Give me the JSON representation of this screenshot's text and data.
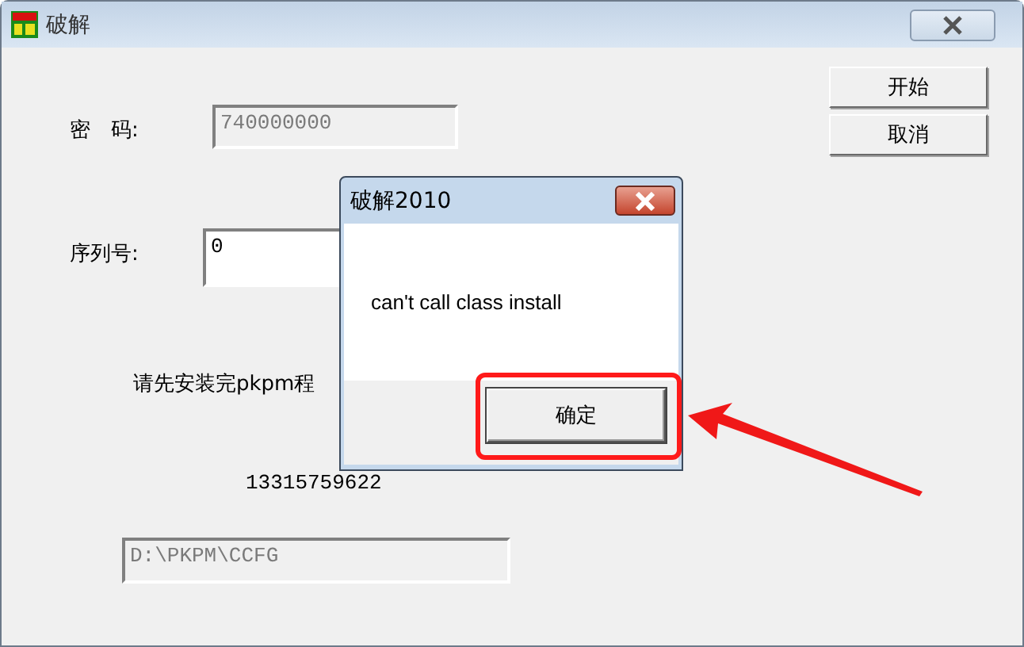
{
  "window": {
    "title": "破解"
  },
  "fields": [
    {
      "label": "密　码:",
      "value": "740000000",
      "disabled": true
    },
    {
      "label": "序列号:",
      "value": "0",
      "disabled": false
    }
  ],
  "notice": "请先安装完pkpm程",
  "phone": "13315759622",
  "path_field": {
    "value": "D:\\PKPM\\CCFG",
    "disabled": true
  },
  "buttons": [
    "开始",
    "取消"
  ],
  "dialog": {
    "title": "破解2010",
    "message": "can't call class install",
    "button": "确定"
  }
}
